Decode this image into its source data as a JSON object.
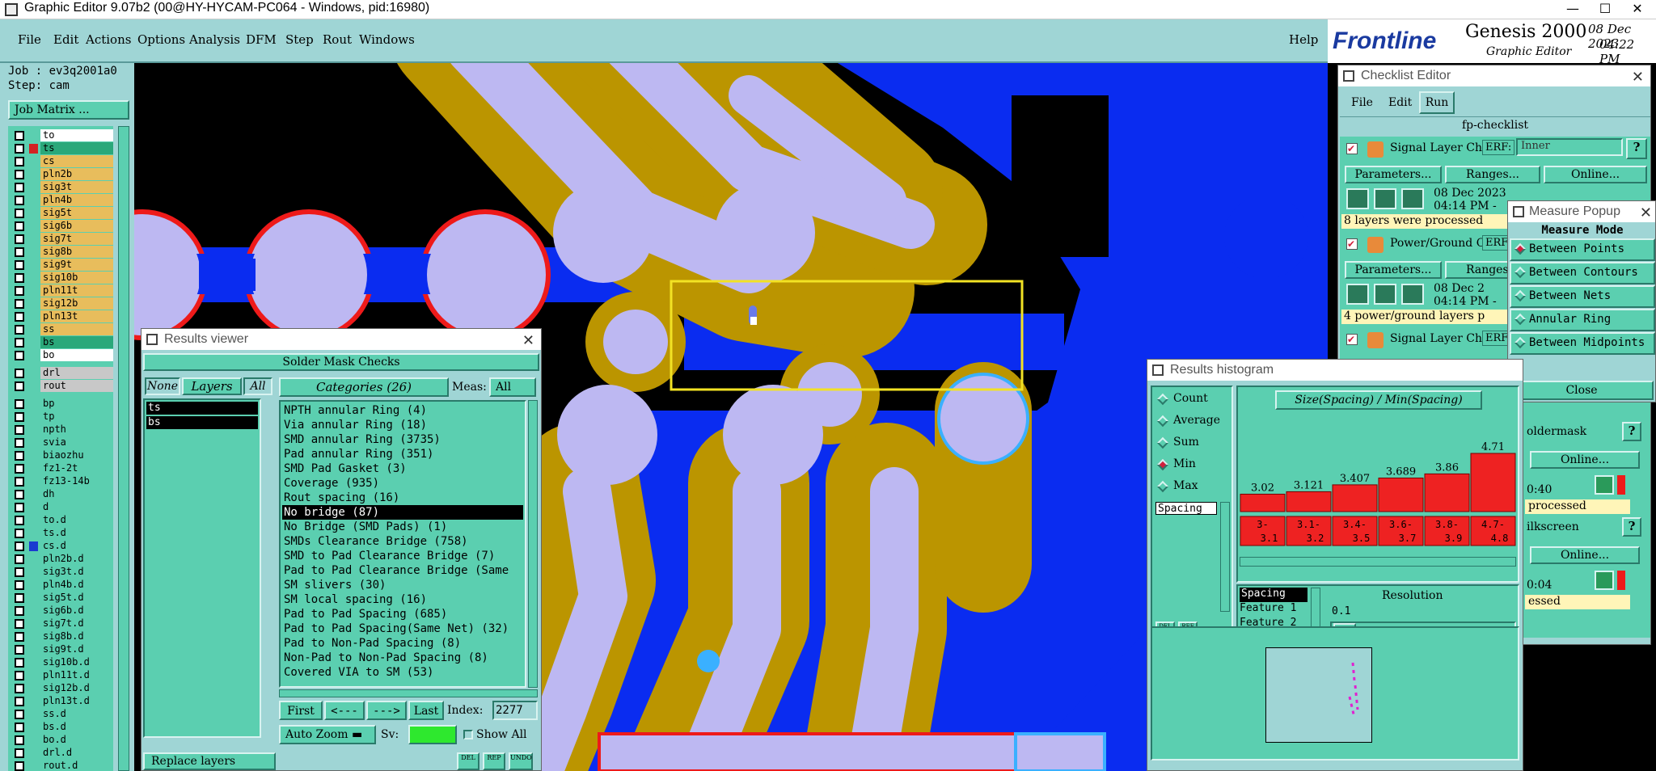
{
  "window": {
    "title": "Graphic Editor 9.07b2 (00@HY-HYCAM-PC064 - Windows, pid:16980)",
    "minimize": "—",
    "maximize": "☐",
    "close": "✕"
  },
  "menu": {
    "items": [
      "File",
      "Edit",
      "Actions",
      "Options",
      "Analysis",
      "DFM",
      "Step",
      "Rout",
      "Windows"
    ],
    "help": "Help"
  },
  "brand": {
    "logo": "Frontline",
    "product": "Genesis 2000",
    "subtitle": "Graphic Editor",
    "date": "08 Dec 2023",
    "time": "04:22 PM"
  },
  "job": {
    "job_label": "Job : ev3q2001a0",
    "step_label": "Step: cam",
    "matrix_button": "Job Matrix ..."
  },
  "layers": [
    {
      "name": "to",
      "color": "#ffffff",
      "ind": ""
    },
    {
      "name": "ts",
      "color": "#2aa87a",
      "ind": "#d22222"
    },
    {
      "name": "cs",
      "color": "#e8bd5c",
      "ind": ""
    },
    {
      "name": "pln2b",
      "color": "#e8bd5c",
      "ind": ""
    },
    {
      "name": "sig3t",
      "color": "#e8bd5c",
      "ind": ""
    },
    {
      "name": "pln4b",
      "color": "#e8bd5c",
      "ind": ""
    },
    {
      "name": "sig5t",
      "color": "#e8bd5c",
      "ind": ""
    },
    {
      "name": "sig6b",
      "color": "#e8bd5c",
      "ind": ""
    },
    {
      "name": "sig7t",
      "color": "#e8bd5c",
      "ind": ""
    },
    {
      "name": "sig8b",
      "color": "#e8bd5c",
      "ind": ""
    },
    {
      "name": "sig9t",
      "color": "#e8bd5c",
      "ind": ""
    },
    {
      "name": "sig10b",
      "color": "#e8bd5c",
      "ind": ""
    },
    {
      "name": "pln11t",
      "color": "#e8bd5c",
      "ind": ""
    },
    {
      "name": "sig12b",
      "color": "#e8bd5c",
      "ind": ""
    },
    {
      "name": "pln13t",
      "color": "#e8bd5c",
      "ind": ""
    },
    {
      "name": "ss",
      "color": "#e8bd5c",
      "ind": ""
    },
    {
      "name": "bs",
      "color": "#2aa87a",
      "ind": ""
    },
    {
      "name": "bo",
      "color": "#ffffff",
      "ind": ""
    },
    {
      "name": "drl",
      "color": "#c8c8c8",
      "ind": ""
    },
    {
      "name": "rout",
      "color": "#c8c8c8",
      "ind": ""
    },
    {
      "name": "bp",
      "color": "#5bcfb0",
      "ind": ""
    },
    {
      "name": "tp",
      "color": "#5bcfb0",
      "ind": ""
    },
    {
      "name": "npth",
      "color": "#5bcfb0",
      "ind": ""
    },
    {
      "name": "svia",
      "color": "#5bcfb0",
      "ind": ""
    },
    {
      "name": "biaozhu",
      "color": "#5bcfb0",
      "ind": ""
    },
    {
      "name": "fz1-2t",
      "color": "#5bcfb0",
      "ind": ""
    },
    {
      "name": "fz13-14b",
      "color": "#5bcfb0",
      "ind": ""
    },
    {
      "name": "dh",
      "color": "#5bcfb0",
      "ind": ""
    },
    {
      "name": "d",
      "color": "#5bcfb0",
      "ind": ""
    },
    {
      "name": "to.d",
      "color": "#5bcfb0",
      "ind": ""
    },
    {
      "name": "ts.d",
      "color": "#5bcfb0",
      "ind": ""
    },
    {
      "name": "cs.d",
      "color": "#5bcfb0",
      "ind": "#1a3ad0"
    },
    {
      "name": "pln2b.d",
      "color": "#5bcfb0",
      "ind": ""
    },
    {
      "name": "sig3t.d",
      "color": "#5bcfb0",
      "ind": ""
    },
    {
      "name": "pln4b.d",
      "color": "#5bcfb0",
      "ind": ""
    },
    {
      "name": "sig5t.d",
      "color": "#5bcfb0",
      "ind": ""
    },
    {
      "name": "sig6b.d",
      "color": "#5bcfb0",
      "ind": ""
    },
    {
      "name": "sig7t.d",
      "color": "#5bcfb0",
      "ind": ""
    },
    {
      "name": "sig8b.d",
      "color": "#5bcfb0",
      "ind": ""
    },
    {
      "name": "sig9t.d",
      "color": "#5bcfb0",
      "ind": ""
    },
    {
      "name": "sig10b.d",
      "color": "#5bcfb0",
      "ind": ""
    },
    {
      "name": "pln11t.d",
      "color": "#5bcfb0",
      "ind": ""
    },
    {
      "name": "sig12b.d",
      "color": "#5bcfb0",
      "ind": ""
    },
    {
      "name": "pln13t.d",
      "color": "#5bcfb0",
      "ind": ""
    },
    {
      "name": "ss.d",
      "color": "#5bcfb0",
      "ind": ""
    },
    {
      "name": "bs.d",
      "color": "#5bcfb0",
      "ind": ""
    },
    {
      "name": "bo.d",
      "color": "#5bcfb0",
      "ind": ""
    },
    {
      "name": "drl.d",
      "color": "#5bcfb0",
      "ind": ""
    },
    {
      "name": "rout.d",
      "color": "#5bcfb0",
      "ind": ""
    }
  ],
  "results_viewer": {
    "title": "Results viewer",
    "header": "Solder Mask Checks",
    "none_btn": "None",
    "layers_btn": "Layers",
    "all_btn": "All",
    "layers": [
      "ts",
      "bs"
    ],
    "categories_btn": "Categories (26)",
    "meas_label": "Meas:",
    "meas_value": "All",
    "categories": [
      "NPTH annular Ring (4)",
      "Via annular Ring (18)",
      "SMD annular Ring (3735)",
      "Pad annular Ring (351)",
      "SMD Pad Gasket (3)",
      "Coverage (935)",
      "Rout spacing (16)",
      "No bridge (87)",
      "No Bridge (SMD Pads) (1)",
      "SMDs Clearance Bridge (758)",
      "SMD to Pad Clearance Bridge (7)",
      "Pad to Pad Clearance Bridge (Same",
      "SM slivers (30)",
      "SM local spacing (16)",
      "Pad to Pad Spacing (685)",
      "Pad to Pad Spacing(Same Net) (32)",
      "Pad to Non-Pad Spacing (8)",
      "Non-Pad to Non-Pad Spacing (8)",
      "Covered VIA to SM (53)"
    ],
    "selected_index": 7,
    "first_btn": "First",
    "prev_btn": "<---",
    "next_btn": "--->",
    "last_btn": "Last",
    "index_label": "Index:",
    "index_value": "2277",
    "zoom_label": "Auto Zoom",
    "sv_label": "Sv:",
    "show_all": "Show All",
    "replace_label": "Replace layers",
    "del_btn": "DEL",
    "rep_btn": "REP",
    "undo_btn": "UNDO"
  },
  "checklist": {
    "title": "Checklist Editor",
    "menu": [
      "File",
      "Edit",
      "Run"
    ],
    "name": "fp-checklist",
    "rows": [
      {
        "label": "Signal Layer Ch",
        "erf": "ERF:",
        "erf_value": "Inner",
        "date": "08 Dec 2023",
        "time": "04:14 PM -",
        "status": "8 layers were processed"
      },
      {
        "label": "Power/Ground C",
        "erf": "ERF:",
        "erf_value": "",
        "date": "08 Dec 2",
        "time": "04:14 PM -",
        "status": "4 power/ground layers p"
      },
      {
        "label": "Signal Layer Ch",
        "erf": "ERF:",
        "erf_value": "",
        "date": "",
        "time": "",
        "status": ""
      }
    ],
    "params_btn": "Parameters...",
    "ranges_btn": "Ranges...",
    "online_btn": "Online...",
    "help_btn": "?",
    "partial": {
      "soldermask": "oldermask",
      "t1": "0:40",
      "processed": "processed",
      "silkscreen": "ilkscreen",
      "t2": "0:04",
      "essed": "essed",
      "online": "Online..."
    }
  },
  "measure_popup": {
    "title": "Measure Popup",
    "mode_label": "Measure Mode",
    "modes": [
      "Between Points",
      "Between Contours",
      "Between Nets",
      "Annular Ring",
      "Between Midpoints"
    ],
    "selected": 0,
    "close_btn": "Close"
  },
  "histogram": {
    "title": "Results histogram",
    "radios": [
      "Count",
      "Average",
      "Sum",
      "Min",
      "Max"
    ],
    "selected": 3,
    "list_item": "Spacing",
    "chart_title": "Size(Spacing) / Min(Spacing)",
    "resolution_label": "Resolution",
    "resolution_value": "0.1",
    "fields": [
      "Spacing",
      "Feature 1",
      "Feature 2"
    ],
    "del_btn": "DEL",
    "ref_btn": "REF"
  },
  "chart_data": {
    "type": "bar",
    "title": "Size(Spacing) / Min(Spacing)",
    "categories": [
      "3-3.1",
      "3.1-3.2",
      "3.4-3.5",
      "3.6-3.7",
      "3.8-3.9",
      "4.7-4.8"
    ],
    "category_top": [
      "3-",
      "3.1-",
      "3.4-",
      "3.6-",
      "3.8-",
      "4.7-"
    ],
    "category_bottom": [
      "3.1",
      "3.2",
      "3.5",
      "3.7",
      "3.9",
      "4.8"
    ],
    "values": [
      3.02,
      3.121,
      3.407,
      3.689,
      3.86,
      4.71
    ],
    "labels": [
      "3.02",
      "3.121",
      "3.407",
      "3.689",
      "3.86",
      "4.71"
    ],
    "bar_color": "#ee2222"
  },
  "colors": {
    "panel": "#9fd5d5",
    "widget": "#5bcfb0",
    "board_blue": "#0a2cf0",
    "copper": "#bb9500",
    "pad": "#bdb8f2",
    "highlight": "#f2e224"
  }
}
